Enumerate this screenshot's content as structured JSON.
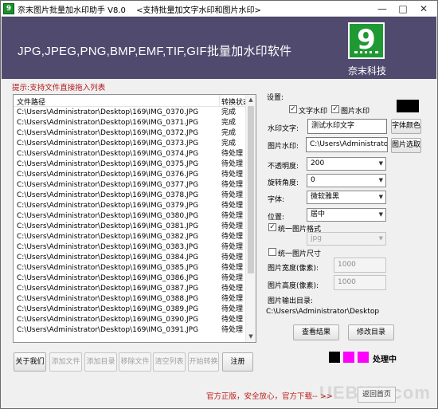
{
  "window": {
    "title": "奈末图片批量加水印助手 V8.0　 <支持批量加文字水印和图片水印>",
    "min_glyph": "—",
    "max_glyph": "□",
    "close_glyph": "✕"
  },
  "banner": {
    "heading": "JPG,JPEG,PNG,BMP,EMF,TIF,GIF批量加水印软件",
    "logo_digit": "9",
    "company": "奈末科技"
  },
  "hint": "提示:支持文件直接拖入列表",
  "file_list": {
    "columns": [
      "文件路径",
      "转换状态"
    ],
    "rows": [
      {
        "path": "C:\\Users\\Administrator\\Desktop\\169\\IMG_0370.JPG",
        "status": "完成"
      },
      {
        "path": "C:\\Users\\Administrator\\Desktop\\169\\IMG_0371.JPG",
        "status": "完成"
      },
      {
        "path": "C:\\Users\\Administrator\\Desktop\\169\\IMG_0372.JPG",
        "status": "完成"
      },
      {
        "path": "C:\\Users\\Administrator\\Desktop\\169\\IMG_0373.JPG",
        "status": "完成"
      },
      {
        "path": "C:\\Users\\Administrator\\Desktop\\169\\IMG_0374.JPG",
        "status": "待处理"
      },
      {
        "path": "C:\\Users\\Administrator\\Desktop\\169\\IMG_0375.JPG",
        "status": "待处理"
      },
      {
        "path": "C:\\Users\\Administrator\\Desktop\\169\\IMG_0376.JPG",
        "status": "待处理"
      },
      {
        "path": "C:\\Users\\Administrator\\Desktop\\169\\IMG_0377.JPG",
        "status": "待处理"
      },
      {
        "path": "C:\\Users\\Administrator\\Desktop\\169\\IMG_0378.JPG",
        "status": "待处理"
      },
      {
        "path": "C:\\Users\\Administrator\\Desktop\\169\\IMG_0379.JPG",
        "status": "待处理"
      },
      {
        "path": "C:\\Users\\Administrator\\Desktop\\169\\IMG_0380.JPG",
        "status": "待处理"
      },
      {
        "path": "C:\\Users\\Administrator\\Desktop\\169\\IMG_0381.JPG",
        "status": "待处理"
      },
      {
        "path": "C:\\Users\\Administrator\\Desktop\\169\\IMG_0382.JPG",
        "status": "待处理"
      },
      {
        "path": "C:\\Users\\Administrator\\Desktop\\169\\IMG_0383.JPG",
        "status": "待处理"
      },
      {
        "path": "C:\\Users\\Administrator\\Desktop\\169\\IMG_0384.JPG",
        "status": "待处理"
      },
      {
        "path": "C:\\Users\\Administrator\\Desktop\\169\\IMG_0385.JPG",
        "status": "待处理"
      },
      {
        "path": "C:\\Users\\Administrator\\Desktop\\169\\IMG_0386.JPG",
        "status": "待处理"
      },
      {
        "path": "C:\\Users\\Administrator\\Desktop\\169\\IMG_0387.JPG",
        "status": "待处理"
      },
      {
        "path": "C:\\Users\\Administrator\\Desktop\\169\\IMG_0388.JPG",
        "status": "待处理"
      },
      {
        "path": "C:\\Users\\Administrator\\Desktop\\169\\IMG_0389.JPG",
        "status": "待处理"
      },
      {
        "path": "C:\\Users\\Administrator\\Desktop\\169\\IMG_0390.JPG",
        "status": "待处理"
      },
      {
        "path": "C:\\Users\\Administrator\\Desktop\\169\\IMG_0391.JPG",
        "status": "待处理"
      }
    ]
  },
  "bottom_buttons": {
    "about": "关于我们",
    "add_file": "添加文件",
    "add_dir": "添加目录",
    "remove_file": "移除文件",
    "clear_list": "清空列表",
    "start": "开始转换",
    "register": "注册"
  },
  "settings": {
    "group_title": "设置:",
    "text_wm_check": "文字水印",
    "image_wm_check": "图片水印",
    "text_wm_label": "水印文字:",
    "text_wm_value": "测试水印文字",
    "font_color_btn": "字体颜色",
    "image_wm_label": "图片水印:",
    "image_wm_value": "C:\\Users\\Administrator\\",
    "image_pick_btn": "图片选取",
    "opacity_label": "不透明度:",
    "opacity_value": "200",
    "rotation_label": "旋转角度:",
    "rotation_value": "0",
    "font_label": "字体:",
    "font_value": "微软雅黑",
    "position_label": "位置:",
    "position_value": "居中",
    "unify_format_check": "统一图片格式",
    "format_value": "jpg",
    "unify_size_check": "统一图片尺寸",
    "width_label": "图片宽度(像素):",
    "width_value": "1000",
    "height_label": "图片高度(像素):",
    "height_value": "1000",
    "output_label": "图片输出目录:",
    "output_value": "C:\\Users\\Administrator\\Desktop",
    "view_result_btn": "查看结果",
    "modify_dir_btn": "修改目录",
    "swatch_color": "#000000",
    "checked_glyph": "✓"
  },
  "status": {
    "processing": "处理中",
    "square_colors": [
      "#000000",
      "#ff00ff",
      "#ff00ff"
    ]
  },
  "footer": {
    "notice": "官方正版，安全放心，官方下载-- >>",
    "back_button": "返回首页",
    "watermark": "UEBUG.com"
  }
}
